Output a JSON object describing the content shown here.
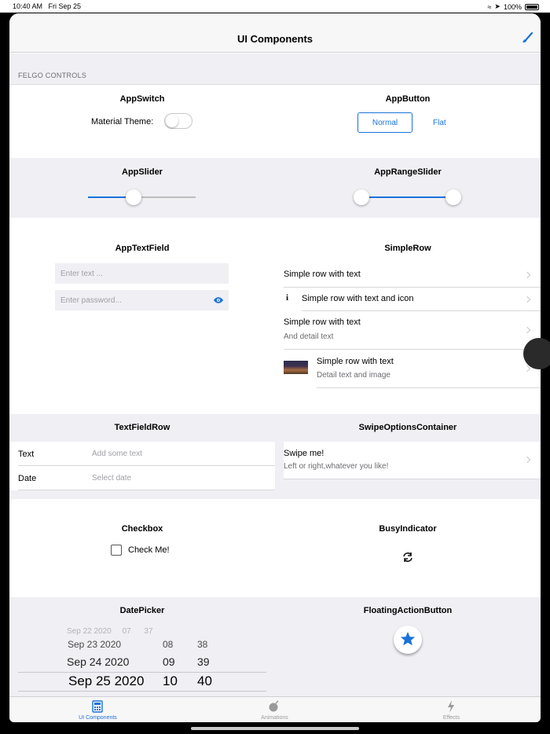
{
  "status_bar": {
    "time": "10:40 AM",
    "date": "Fri Sep 25",
    "battery": "100%"
  },
  "navbar": {
    "title": "UI Components",
    "action_icon": "brush-icon"
  },
  "section": {
    "header": "FELGO CONTROLS"
  },
  "app_switch": {
    "title": "AppSwitch",
    "label": "Material Theme:",
    "checked": false
  },
  "app_button": {
    "title": "AppButton",
    "normal_label": "Normal",
    "flat_label": "Flat"
  },
  "app_slider": {
    "title": "AppSlider",
    "value": 0.42
  },
  "app_range_slider": {
    "title": "AppRangeSlider",
    "low": 0.0,
    "high": 1.0
  },
  "app_text_field": {
    "title": "AppTextField",
    "text_placeholder": "Enter text ...",
    "password_placeholder": "Enter password..."
  },
  "simple_row": {
    "title": "SimpleRow",
    "rows": [
      {
        "text": "Simple row with text"
      },
      {
        "text": "Simple row with text and icon",
        "icon": "info-icon"
      },
      {
        "text": "Simple row with text",
        "detail": "And detail text"
      },
      {
        "text": "Simple row with text",
        "detail": "Detail text and image"
      }
    ]
  },
  "text_field_row": {
    "title": "TextFieldRow",
    "rows": [
      {
        "label": "Text",
        "placeholder": "Add some text"
      },
      {
        "label": "Date",
        "placeholder": "Select date"
      }
    ]
  },
  "swipe_options": {
    "title": "SwipeOptionsContainer",
    "text": "Swipe me!",
    "detail": "Left or right,whatever you like!"
  },
  "checkbox": {
    "title": "Checkbox",
    "label": "Check Me!",
    "checked": false
  },
  "busy_indicator": {
    "title": "BusyIndicator"
  },
  "date_picker": {
    "title": "DatePicker",
    "rows": [
      {
        "date": "Sep 23 2020",
        "hour": "08",
        "minute": "38"
      },
      {
        "date": "Sep 24 2020",
        "hour": "09",
        "minute": "39"
      },
      {
        "date": "Sep 25 2020",
        "hour": "10",
        "minute": "40"
      }
    ]
  },
  "fab": {
    "title": "FloatingActionButton",
    "icon": "star-icon"
  },
  "tabs": [
    {
      "label": "UI Components",
      "icon": "calculator-icon",
      "active": true
    },
    {
      "label": "Animations",
      "icon": "bomb-icon",
      "active": false
    },
    {
      "label": "Effects",
      "icon": "lightning-icon",
      "active": false
    }
  ],
  "colors": {
    "accent": "#1a73d9",
    "section_bg": "#efeff4"
  }
}
